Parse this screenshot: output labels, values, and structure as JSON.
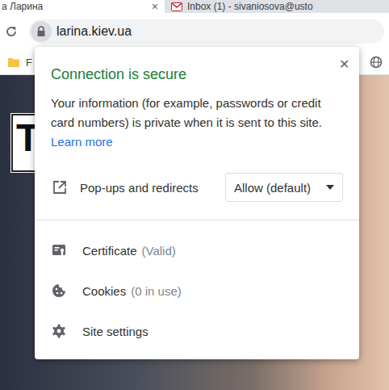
{
  "tabs": [
    {
      "label": "а Ларина",
      "close": "×",
      "selected": true
    },
    {
      "label": "Inbox (1) - sivaniosova@usto",
      "selected": false
    }
  ],
  "address_bar": {
    "url": "larina.kiev.ua"
  },
  "bookmarks": [
    {
      "label": "F"
    }
  ],
  "page": {
    "logo": "T"
  },
  "popup": {
    "title": "Connection is secure",
    "close": "✕",
    "description": "Your information (for example, passwords or credit card numbers) is private when it is sent to this site.",
    "link": "Learn more",
    "setting": {
      "label": "Pop-ups and redirects",
      "value": "Allow (default)"
    },
    "items": [
      {
        "label": "Certificate",
        "detail": "(Valid)",
        "kind": "certificate"
      },
      {
        "label": "Cookies",
        "detail": "(0 in use)",
        "kind": "cookies"
      },
      {
        "label": "Site settings",
        "kind": "settings"
      }
    ]
  }
}
